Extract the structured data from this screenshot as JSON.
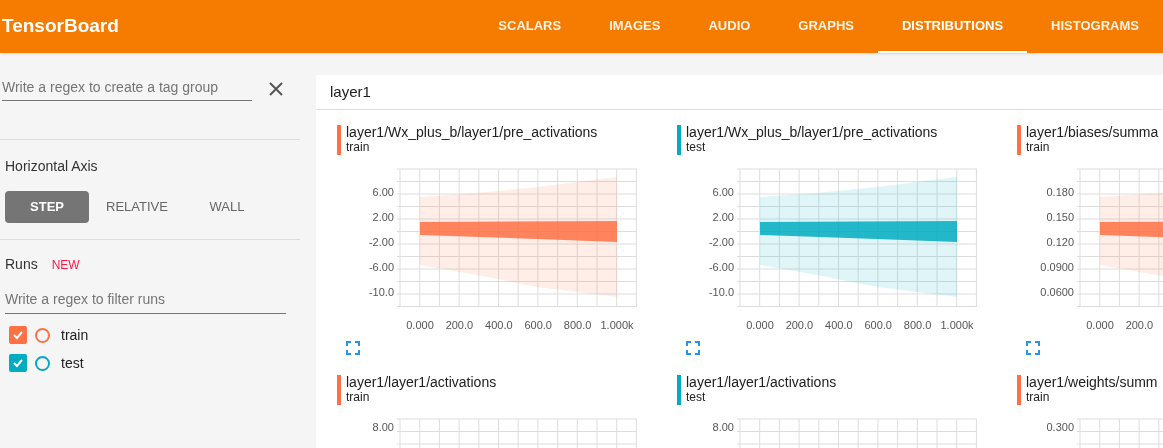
{
  "header": {
    "title": "TensorBoard",
    "tabs": [
      {
        "label": "SCALARS",
        "selected": false
      },
      {
        "label": "IMAGES",
        "selected": false
      },
      {
        "label": "AUDIO",
        "selected": false
      },
      {
        "label": "GRAPHS",
        "selected": false
      },
      {
        "label": "DISTRIBUTIONS",
        "selected": true
      },
      {
        "label": "HISTOGRAMS",
        "selected": false
      }
    ]
  },
  "sidebar": {
    "tag_filter": {
      "placeholder": "Write a regex to create a tag group"
    },
    "horizontal_axis": {
      "label": "Horizontal Axis",
      "options": [
        {
          "label": "STEP",
          "selected": true
        },
        {
          "label": "RELATIVE",
          "selected": false
        },
        {
          "label": "WALL",
          "selected": false
        }
      ]
    },
    "runs": {
      "label": "Runs",
      "badge": "NEW",
      "filter": {
        "placeholder": "Write a regex to filter runs"
      },
      "items": [
        {
          "name": "train",
          "color": "#ff7043",
          "checked": true
        },
        {
          "name": "test",
          "color": "#00acc1",
          "checked": true
        }
      ]
    }
  },
  "main": {
    "group_title": "layer1",
    "cards": [
      {
        "title": "layer1/Wx_plus_b/layer1/pre_activations",
        "run": "train",
        "color": "#ff7043",
        "y_ticks": [
          "6.00",
          "2.00",
          "-2.00",
          "-6.00",
          "-10.0"
        ],
        "x_ticks": [
          "0.000",
          "200.0",
          "400.0",
          "600.0",
          "800.0",
          "1.000k"
        ]
      },
      {
        "title": "layer1/Wx_plus_b/layer1/pre_activations",
        "run": "test",
        "color": "#00acc1",
        "y_ticks": [
          "6.00",
          "2.00",
          "-2.00",
          "-6.00",
          "-10.0"
        ],
        "x_ticks": [
          "0.000",
          "200.0",
          "400.0",
          "600.0",
          "800.0",
          "1.000k"
        ]
      },
      {
        "title": "layer1/biases/summa",
        "run": "train",
        "color": "#ff7043",
        "y_ticks": [
          "0.180",
          "0.150",
          "0.120",
          "0.0900",
          "0.0600"
        ],
        "x_ticks": [
          "0.000",
          "200.0"
        ]
      },
      {
        "title": "layer1/layer1/activations",
        "run": "train",
        "color": "#ff7043",
        "y_ticks": [
          "8.00"
        ]
      },
      {
        "title": "layer1/layer1/activations",
        "run": "test",
        "color": "#00acc1",
        "y_ticks": [
          "8.00"
        ]
      },
      {
        "title": "layer1/weights/summ",
        "run": "train",
        "color": "#ff7043",
        "y_ticks": [
          "0.300"
        ]
      }
    ]
  }
}
